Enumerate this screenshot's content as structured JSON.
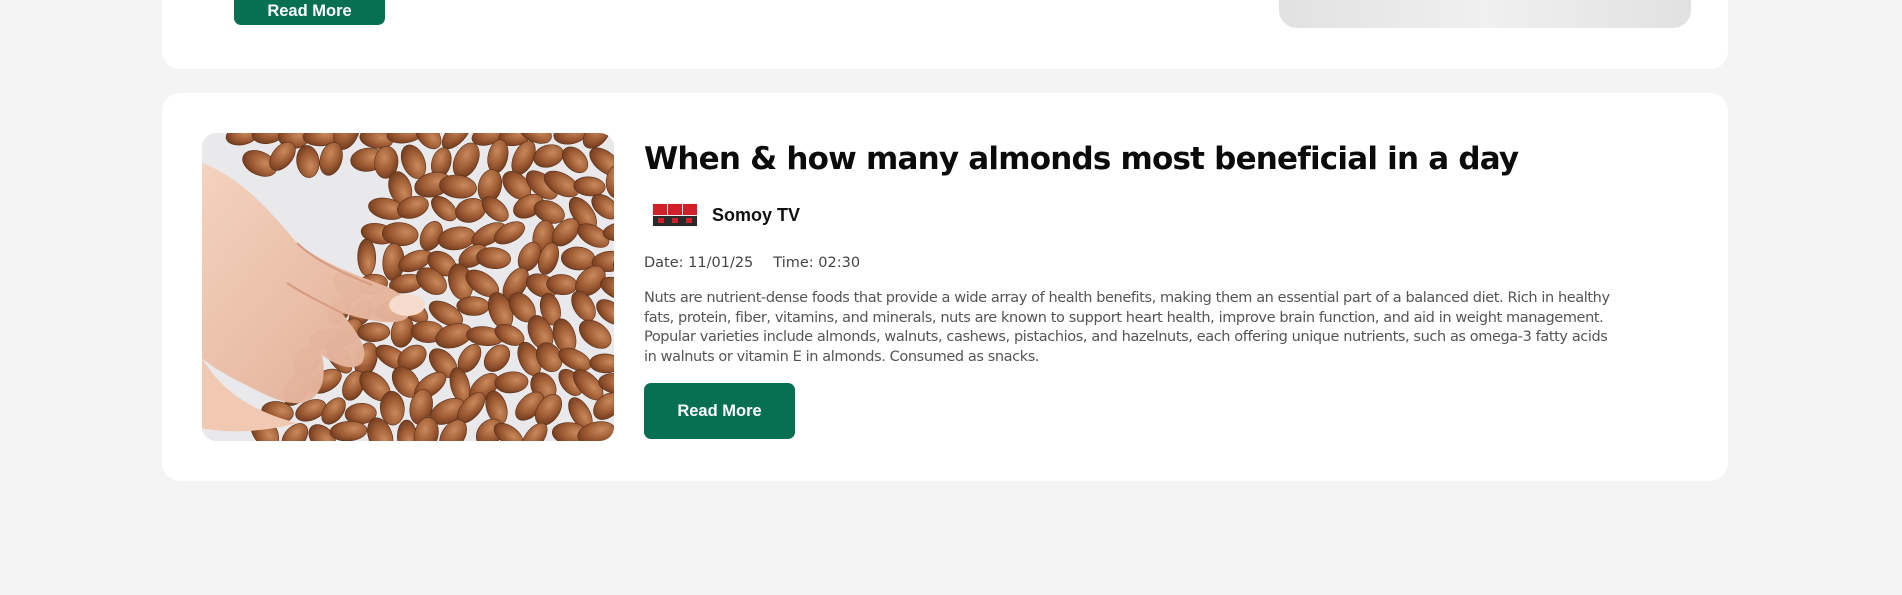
{
  "colors": {
    "page_background": "#f4f4f4",
    "card_background": "#ffffff",
    "accent_button": "#077052",
    "button_text": "#ffffff",
    "title_text": "#0b0b0b",
    "body_text": "#555555"
  },
  "previous_article": {
    "read_more_label": "Read More"
  },
  "article": {
    "title": "When & how many almonds most beneficial in a day",
    "source_name": "Somoy TV",
    "source_logo_icon": "somoy-tv-logo",
    "date_text": "Date: 11/01/25",
    "time_text": "Time: 02:30",
    "description": "Nuts are nutrient-dense foods that provide a wide array of health benefits, making them an essential part of a balanced diet. Rich in healthy fats, protein, fiber, vitamins, and minerals, nuts are known to support heart health, improve brain function, and aid in weight management. Popular varieties include almonds, walnuts, cashews, pistachios, and hazelnuts, each offering unique nutrients, such as omega-3 fatty acids in walnuts or vitamin E in almonds. Consumed as snacks.",
    "read_more_label": "Read More",
    "image_subject": "hand-picking-almonds"
  }
}
